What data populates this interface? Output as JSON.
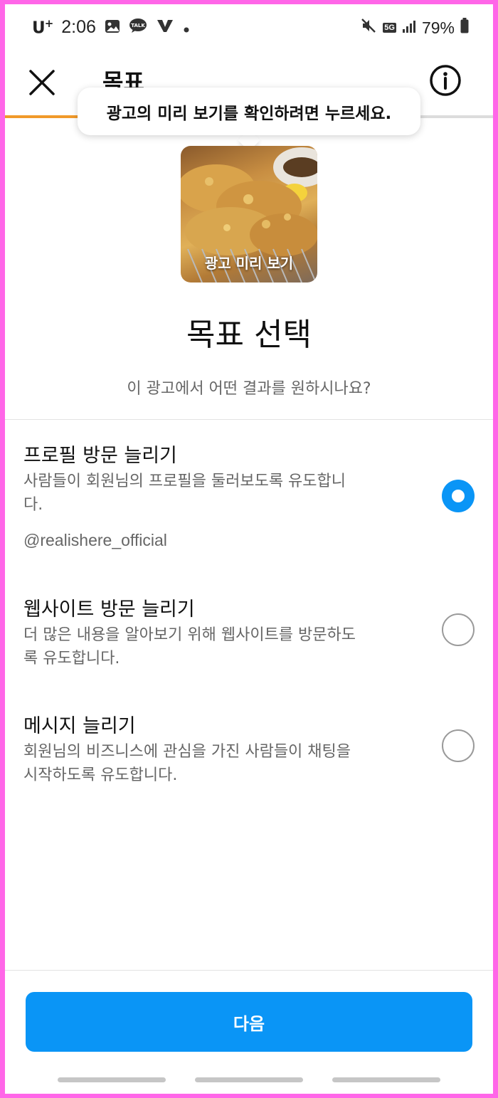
{
  "status_bar": {
    "carrier": "U",
    "carrier_sup": "+",
    "time": "2:06",
    "network": "5G",
    "battery": "79%"
  },
  "header": {
    "title": "목표"
  },
  "progress": {
    "fraction": 0.15
  },
  "tooltip": {
    "text": "광고의 미리 보기를 확인하려면 누르세요."
  },
  "preview": {
    "label": "광고 미리 보기"
  },
  "main": {
    "title": "목표 선택",
    "subtitle": "이 광고에서 어떤 결과를 원하시나요?"
  },
  "options": [
    {
      "title": "프로필 방문 늘리기",
      "description": "사람들이 회원님의 프로필을 둘러보도록 유도합니다.",
      "handle": "@realishere_official",
      "selected": true
    },
    {
      "title": "웹사이트 방문 늘리기",
      "description": "더 많은 내용을 알아보기 위해 웹사이트를 방문하도록 유도합니다.",
      "selected": false
    },
    {
      "title": "메시지 늘리기",
      "description": "회원님의 비즈니스에 관심을 가진 사람들이 채팅을 시작하도록 유도합니다.",
      "selected": false
    }
  ],
  "footer": {
    "next_label": "다음"
  },
  "colors": {
    "accent": "#0a95f6",
    "progress": "#f19a2a",
    "frame": "#ff66e8"
  }
}
